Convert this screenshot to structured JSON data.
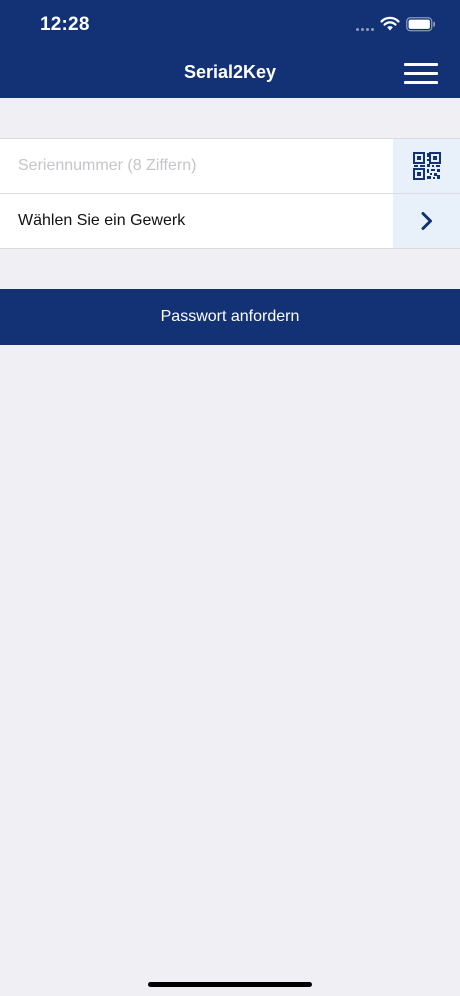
{
  "status_bar": {
    "time": "12:28"
  },
  "nav": {
    "title": "Serial2Key",
    "menu_icon": "hamburger-menu-icon"
  },
  "form": {
    "serial_placeholder": "Seriennummer (8 Ziffern)",
    "serial_value": "",
    "scan_icon": "qr-code-icon",
    "trade_label": "Wählen Sie ein Gewerk",
    "trade_icon": "chevron-right-icon"
  },
  "actions": {
    "request_label": "Passwort anfordern"
  },
  "colors": {
    "brand": "#123275",
    "background": "#efeff4",
    "accent_light": "#e8f0fa"
  }
}
